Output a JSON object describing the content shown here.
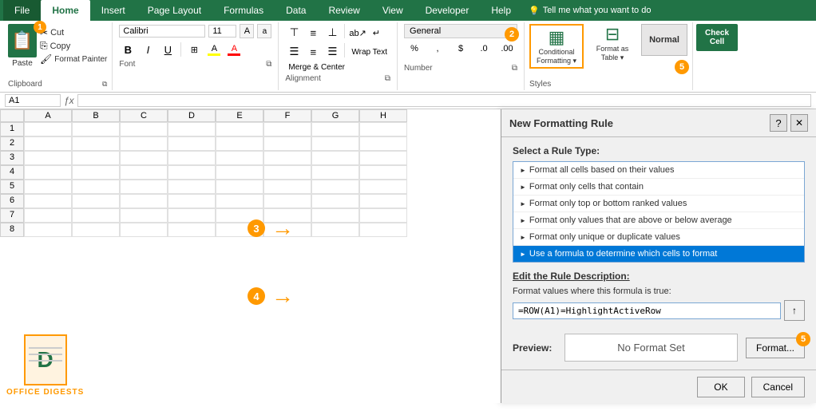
{
  "ribbon": {
    "tabs": [
      "File",
      "Home",
      "Insert",
      "Page Layout",
      "Formulas",
      "Data",
      "Review",
      "View",
      "Developer",
      "Help"
    ],
    "active_tab": "Home",
    "tell_me": "Tell me what you want to do",
    "clipboard": {
      "group_label": "Clipboard",
      "paste_label": "Paste",
      "cut_label": "Cut",
      "copy_label": "Copy",
      "format_painter_label": "Format Painter",
      "badges": {
        "cut": "1",
        "copy": null,
        "format_painter": null
      }
    },
    "font": {
      "group_label": "Font",
      "font_name": "Calibri",
      "font_size": "11",
      "bold": "B",
      "italic": "I",
      "underline": "U"
    },
    "alignment": {
      "group_label": "Alignment",
      "wrap_text": "Wrap Text",
      "merge_center": "Merge & Center"
    },
    "number": {
      "group_label": "Number",
      "format": "General",
      "badge": "2"
    },
    "styles": {
      "group_label": "Styles",
      "conditional_label": "Conditional\nFormatting ▾",
      "format_table_label": "Format as\nTable ▾",
      "normal_label": "Normal",
      "badge": "5"
    }
  },
  "dialog": {
    "title": "New Formatting Rule",
    "help_button": "?",
    "close_button": "✕",
    "select_rule_label": "Select a Rule Type:",
    "rules": [
      "Format all cells based on their values",
      "Format only cells that contain",
      "Format only top or bottom ranked values",
      "Format only values that are above or below average",
      "Format only unique or duplicate values",
      "Use a formula to determine which cells to format"
    ],
    "selected_rule_index": 5,
    "edit_rule_label": "Edit the Rule Description:",
    "formula_label": "Format values where this formula is true:",
    "formula_value": "=ROW(A1)=HighlightActiveRow",
    "preview_label": "Preview:",
    "preview_text": "No Format Set",
    "format_button": "Format...",
    "ok_button": "OK",
    "cancel_button": "Cancel"
  },
  "arrows": {
    "badge3": "3",
    "badge4": "4"
  },
  "logo": {
    "letter": "D",
    "text": "OFFICE DIGESTS"
  }
}
